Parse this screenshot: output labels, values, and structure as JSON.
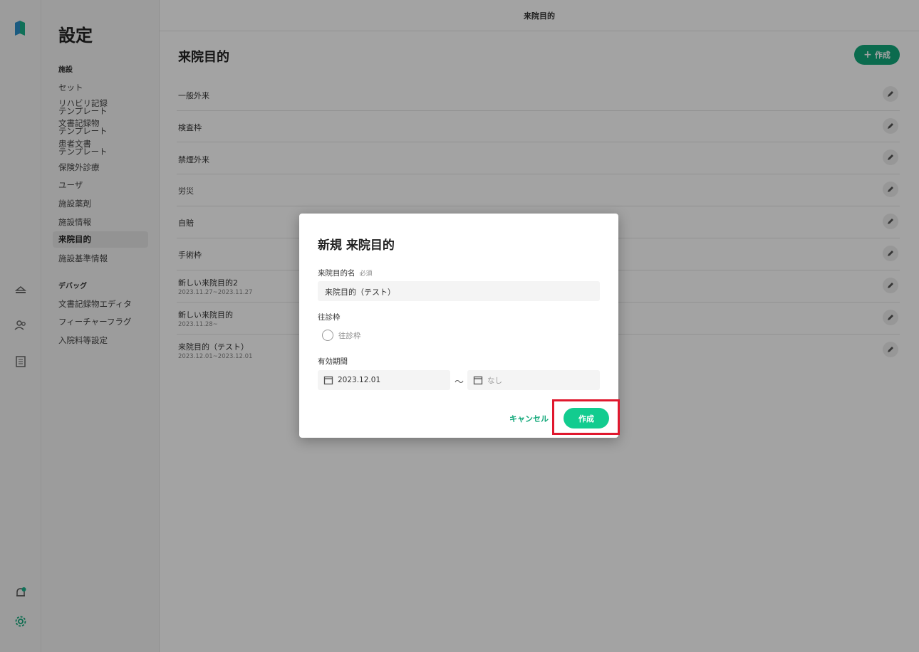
{
  "rail": {
    "icons": [
      "logo-icon",
      "bed-icon",
      "users-icon",
      "list-icon",
      "bell-icon",
      "gear-icon"
    ]
  },
  "sidebar": {
    "title": "設定",
    "section_facility": "施設",
    "items_facility": [
      {
        "label": "セット"
      },
      {
        "label": "リハビリ記録\nテンプレート"
      },
      {
        "label": "文書記録物\nテンプレート"
      },
      {
        "label": "患者文書\nテンプレート"
      },
      {
        "label": "保険外診療"
      },
      {
        "label": "ユーザ"
      },
      {
        "label": "施設薬剤"
      },
      {
        "label": "施設情報"
      },
      {
        "label": "来院目的"
      },
      {
        "label": "施設基準情報"
      }
    ],
    "section_debug": "デバッグ",
    "items_debug": [
      {
        "label": "文書記録物エディタ"
      },
      {
        "label": "フィーチャーフラグ"
      },
      {
        "label": "入院料等設定"
      }
    ]
  },
  "header": {
    "title": "来院目的"
  },
  "main": {
    "title": "来院目的",
    "create_label": "作成",
    "rows": [
      {
        "name": "一般外来",
        "sub": ""
      },
      {
        "name": "検査枠",
        "sub": ""
      },
      {
        "name": "禁煙外来",
        "sub": ""
      },
      {
        "name": "労災",
        "sub": ""
      },
      {
        "name": "自賠",
        "sub": ""
      },
      {
        "name": "手術枠",
        "sub": ""
      },
      {
        "name": "新しい来院目的2",
        "sub": "2023.11.27~2023.11.27"
      },
      {
        "name": "新しい来院目的",
        "sub": "2023.11.28~"
      },
      {
        "name": "来院目的（テスト）",
        "sub": "2023.12.01~2023.12.01"
      }
    ]
  },
  "dialog": {
    "title": "新規 来院目的",
    "name_label": "来院目的名",
    "required": "必須",
    "name_value": "来院目的（テスト）",
    "house_call_label": "往診枠",
    "house_call_option": "往診枠",
    "period_label": "有効期間",
    "start_date": "2023.12.01",
    "tilde": "〜",
    "end_placeholder": "なし",
    "cancel_label": "キャンセル",
    "create_label": "作成"
  },
  "colors": {
    "accent": "#12a87a",
    "accent_bright": "#12cc8f",
    "highlight": "#e0182e"
  }
}
